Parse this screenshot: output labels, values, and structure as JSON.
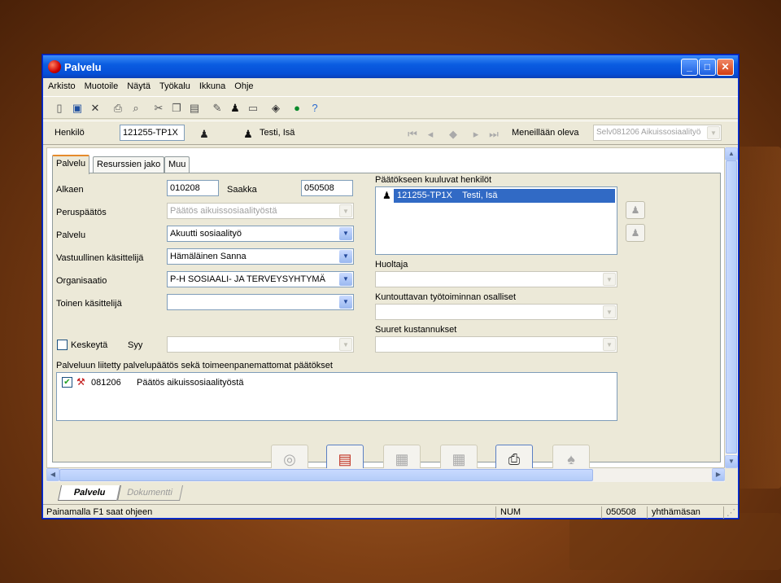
{
  "window": {
    "title": "Palvelu"
  },
  "menu": [
    "Arkisto",
    "Muotoile",
    "Näytä",
    "Työkalu",
    "Ikkuna",
    "Ohje"
  ],
  "henkilo": {
    "label": "Henkilö",
    "id": "121255-TP1X",
    "name": "Testi, Isä",
    "meneillaan_label": "Meneillään oleva",
    "meneillaan_value": "Selv081206 Aikuissosiaalityö"
  },
  "tabs": [
    "Palvelu",
    "Resurssien jako",
    "Muu"
  ],
  "form": {
    "alkaen_label": "Alkaen",
    "alkaen": "010208",
    "saakka_label": "Saakka",
    "saakka": "050508",
    "peruspaatos_label": "Peruspäätös",
    "peruspaatos": "Päätös aikuissosiaalityöstä",
    "palvelu_label": "Palvelu",
    "palvelu": "Akuutti sosiaalityö",
    "vastuullinen_label": "Vastuullinen käsittelijä",
    "vastuullinen": "Hämäläinen Sanna",
    "organisaatio_label": "Organisaatio",
    "organisaatio": "P-H SOSIAALI- JA TERVEYSYHTYMÄ",
    "toinen_label": "Toinen käsittelijä",
    "toinen": "",
    "keskeyta_label": "Keskeytä",
    "syy_label": "Syy"
  },
  "right": {
    "henkilot_label": "Päätökseen kuuluvat henkilöt",
    "henkilot": [
      {
        "id": "121255-TP1X",
        "name": "Testi, Isä"
      }
    ],
    "huoltaja_label": "Huoltaja",
    "kuntouttava_label": "Kuntouttavan työtoiminnan osalliset",
    "suuret_label": "Suuret kustannukset"
  },
  "liitetty": {
    "label": "Palveluun liitetty palvelupäätös sekä toimeenpanemattomat päätökset",
    "items": [
      {
        "code": "081206",
        "text": "Päätös aikuissosiaalityöstä",
        "checked": true
      }
    ]
  },
  "doctabs": [
    "Palvelu",
    "Dokumentti"
  ],
  "status": {
    "hint": "Painamalla F1 saat ohjeen",
    "num": "NUM",
    "date": "050508",
    "user": "yhthämäsan"
  }
}
